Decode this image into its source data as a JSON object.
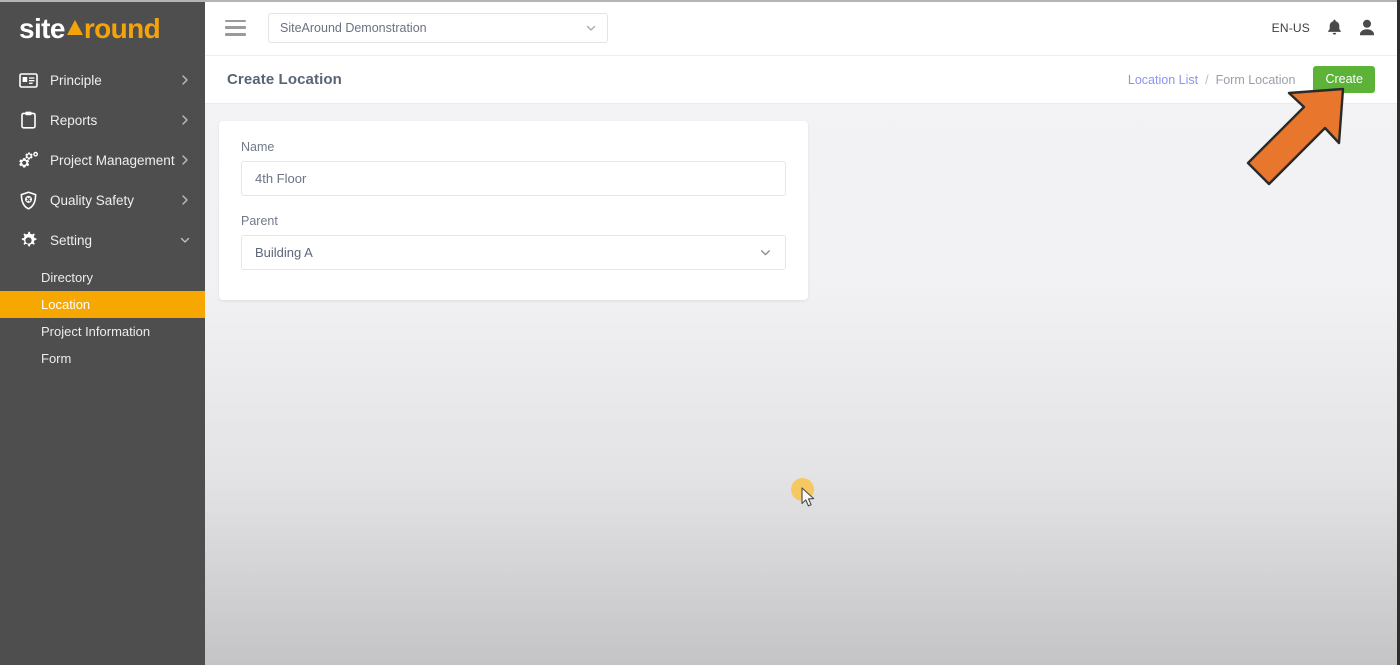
{
  "brand": {
    "logo_part1": "site",
    "logo_part2": "round",
    "logo_triangle_icon": "triangle-play-icon",
    "accent_color": "#f5a30a"
  },
  "sidebar": {
    "items": [
      {
        "label": "Principle",
        "icon": "id-card-icon",
        "chevron": "chevron-right-icon",
        "expanded": false
      },
      {
        "label": "Reports",
        "icon": "clipboard-icon",
        "chevron": "chevron-right-icon",
        "expanded": false
      },
      {
        "label": "Project Management",
        "icon": "gears-icon",
        "chevron": "chevron-right-icon",
        "expanded": false
      },
      {
        "label": "Quality Safety",
        "icon": "shield-x-icon",
        "chevron": "chevron-right-icon",
        "expanded": false
      },
      {
        "label": "Setting",
        "icon": "gear-icon",
        "chevron": "chevron-down-icon",
        "expanded": true
      }
    ],
    "sub_items": [
      {
        "label": "Directory",
        "active": false
      },
      {
        "label": "Location",
        "active": true
      },
      {
        "label": "Project Information",
        "active": false
      },
      {
        "label": "Form",
        "active": false
      }
    ],
    "active_color": "#f6a700",
    "background_color": "#4e4e4e"
  },
  "topbar": {
    "menu_icon": "hamburger-icon",
    "project_select_value": "SiteAround Demonstration",
    "project_select_chevron": "chevron-down-icon",
    "language": "EN-US",
    "bell_icon": "bell-icon",
    "user_icon": "user-avatar-icon"
  },
  "pagehead": {
    "title": "Create Location",
    "breadcrumb": {
      "link": "Location List",
      "separator": "/",
      "current": "Form Location"
    },
    "create_button": "Create",
    "create_button_color": "#5cb338"
  },
  "form": {
    "fields": [
      {
        "label": "Name",
        "type": "text",
        "value": "4th Floor",
        "placeholder": "4th Floor"
      },
      {
        "label": "Parent",
        "type": "select",
        "value": "Building A",
        "chevron": "chevron-down-icon"
      }
    ]
  },
  "annotations": {
    "cursor": {
      "icon": "mouse-cursor-icon",
      "highlight_color": "#f6c557"
    },
    "pointer_arrow": {
      "icon": "arrow-up-right-icon",
      "color": "#e8762c",
      "points_to": "Create"
    }
  }
}
